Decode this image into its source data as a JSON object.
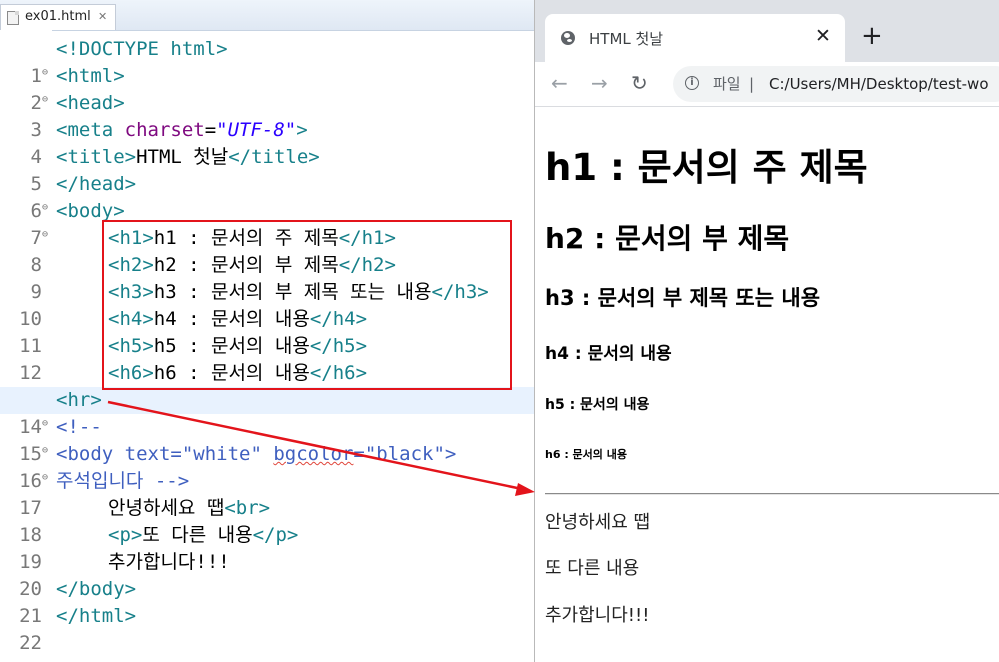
{
  "editor": {
    "tab_label": "ex01.html",
    "tab_close": "✕",
    "lines": [
      {
        "n": "1"
      },
      {
        "n": "2"
      },
      {
        "n": "3"
      },
      {
        "n": "4"
      },
      {
        "n": "5"
      },
      {
        "n": "6"
      },
      {
        "n": "7"
      },
      {
        "n": "8"
      },
      {
        "n": "9"
      },
      {
        "n": "10"
      },
      {
        "n": "11"
      },
      {
        "n": "12"
      },
      {
        "n": "13"
      },
      {
        "n": "14"
      },
      {
        "n": "15"
      },
      {
        "n": "16"
      },
      {
        "n": "17"
      },
      {
        "n": "18"
      },
      {
        "n": "19"
      },
      {
        "n": "20"
      },
      {
        "n": "21"
      },
      {
        "n": "22"
      }
    ],
    "code": {
      "l1_tag": "<!DOCTYPE html>",
      "l2_tag": "<html>",
      "l3_tag": "<head>",
      "l4_tag_open": "<meta ",
      "l4_attr": "charset",
      "l4_eq": "=",
      "l4_str": "\"UTF-8\"",
      "l4_tag_close": ">",
      "l5_tag_open": "<title>",
      "l5_text": "HTML 첫날",
      "l5_tag_close": "</title>",
      "l6_tag": "</head>",
      "l7_tag": "<body>",
      "l8_open": "<h1>",
      "l8_text": "h1 : 문서의 주 제목",
      "l8_close": "</h1>",
      "l9_open": "<h2>",
      "l9_text": "h2 : 문서의 부 제목",
      "l9_close": "</h2>",
      "l10_open": "<h3>",
      "l10_text": "h3 : 문서의 부 제목 또는 내용",
      "l10_close": "</h3>",
      "l11_open": "<h4>",
      "l11_text": "h4 : 문서의 내용",
      "l11_close": "</h4>",
      "l12_open": "<h5>",
      "l12_text": "h5 : 문서의 내용",
      "l12_close": "</h5>",
      "l13_open": "<h6>",
      "l13_text": "h6 : 문서의 내용",
      "l13_close": "</h6>",
      "l14_tag": "<hr>",
      "l15_com": "<!--",
      "l16_com_a": "<body text=\"white\" ",
      "l16_com_b": "bgcolor",
      "l16_com_c": "=\"black\">",
      "l17_com": "주석입니다 -->",
      "l18_text": "안녕하세요 땝",
      "l18_tag": "<br>",
      "l19_open": "<p>",
      "l19_text": "또 다른 내용",
      "l19_close": "</p>",
      "l20_text": "추가합니다!!!",
      "l21_tag": "</body>",
      "l22_tag": "</html>"
    }
  },
  "browser": {
    "tab_title": "HTML 첫날",
    "tab_close": "✕",
    "new_tab": "+",
    "back": "←",
    "forward": "→",
    "reload": "↻",
    "info": "i",
    "omnibox_scheme": "파일",
    "omnibox_sep": "|",
    "omnibox_url": "C:/Users/MH/Desktop/test-wo"
  },
  "page": {
    "h1": "h1 : 문서의 주 제목",
    "h2": "h2 : 문서의 부 제목",
    "h3": "h3 : 문서의 부 제목 또는 내용",
    "h4": "h4 : 문서의 내용",
    "h5": "h5 : 문서의 내용",
    "h6": "h6 : 문서의 내용",
    "text1": "안녕하세요 땝",
    "text2": "또 다른 내용",
    "text3": "추가합니다!!!"
  },
  "colors": {
    "annotation_red": "#e3141b",
    "tag_teal": "#17808a",
    "attr_purple": "#7f0a80",
    "string_blue": "#2a00ff",
    "comment_blue": "#3f5fbf"
  }
}
